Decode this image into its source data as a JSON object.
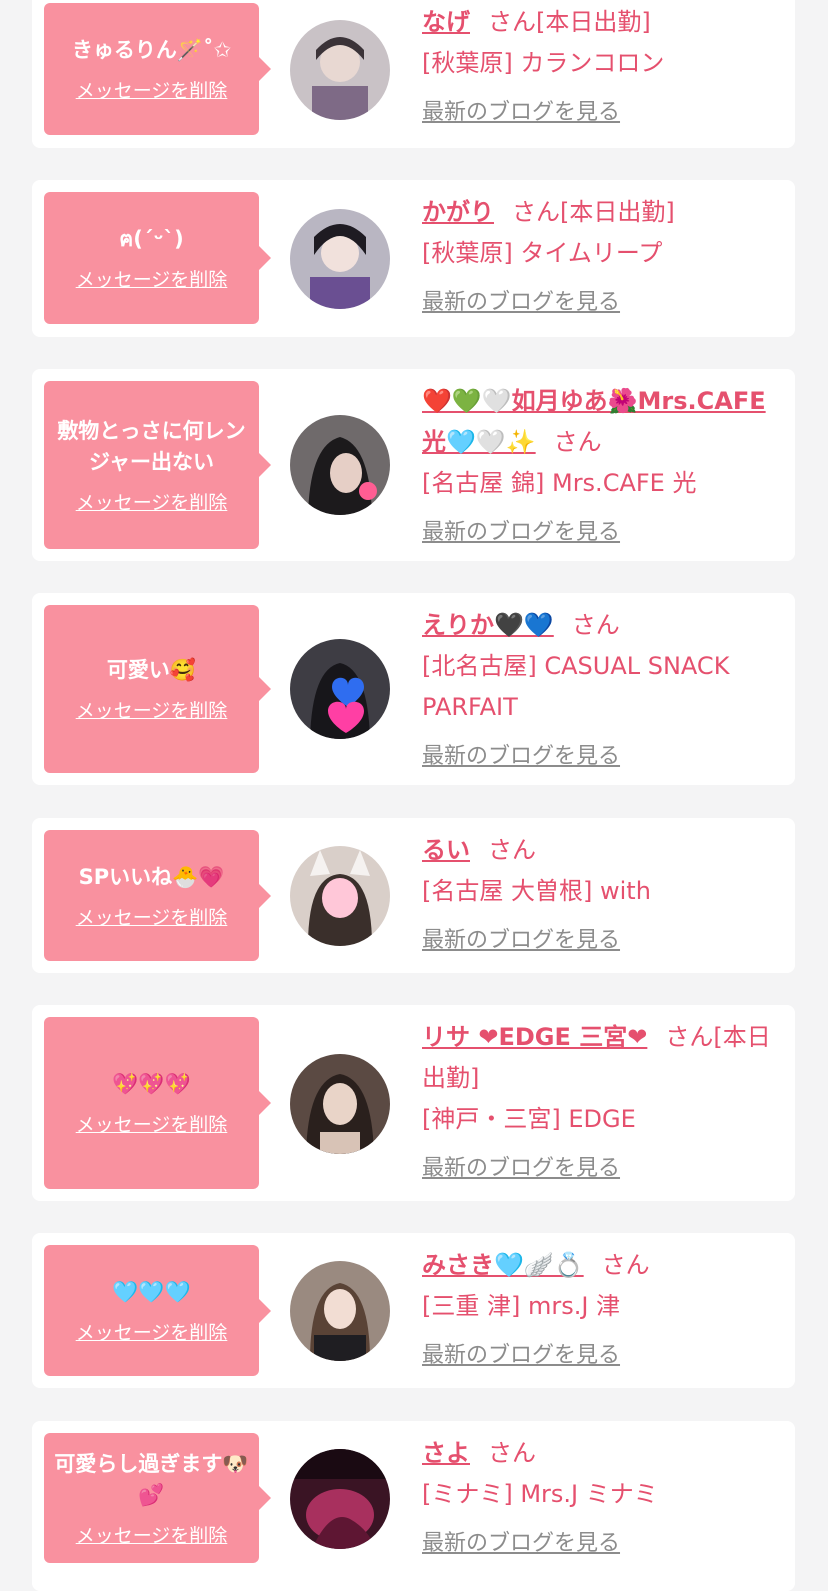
{
  "delete_label": "メッセージを削除",
  "blog_label": "最新のブログを見る",
  "colors": {
    "bubble": "#f9919f",
    "accent": "#e5506e",
    "muted": "#8c8c8c"
  },
  "entries": [
    {
      "message": "きゅるりん🪄˚✩",
      "name": "なげ",
      "suffix": "さん[本日出勤]",
      "shop": "[秋葉原] カランコロン"
    },
    {
      "message": "ฅ(ˊᵕˋ)",
      "name": "かがり",
      "suffix": "さん[本日出勤]",
      "shop": "[秋葉原] タイムリープ"
    },
    {
      "message": "敷物とっさに何レンジャー出ない",
      "name": "❤️💚🤍如月ゆあ🌺Mrs.CAFE光🩵🤍✨",
      "suffix": "さん",
      "shop": "[名古屋 錦] Mrs.CAFE 光"
    },
    {
      "message": "可愛い🥰",
      "name": "えりか🖤💙",
      "suffix": "さん",
      "shop": "[北名古屋] CASUAL SNACK PARFAIT"
    },
    {
      "message": "SPいいね🐣💗",
      "name": "るい",
      "suffix": "さん",
      "shop": "[名古屋 大曽根] with"
    },
    {
      "message": "💖💖💖",
      "name": "リサ ❤EDGE 三宮❤",
      "suffix": "さん[本日出勤]",
      "shop": "[神戸・三宮] EDGE"
    },
    {
      "message": "🩵🩵🩵",
      "name": "みさき🩵🪽💍",
      "suffix": "さん",
      "shop": "[三重 津] mrs.J 津"
    },
    {
      "message": "可愛らし過ぎます🐶💕",
      "name": "さよ",
      "suffix": "さん",
      "shop": "[ミナミ] Mrs.J ミナミ"
    }
  ]
}
